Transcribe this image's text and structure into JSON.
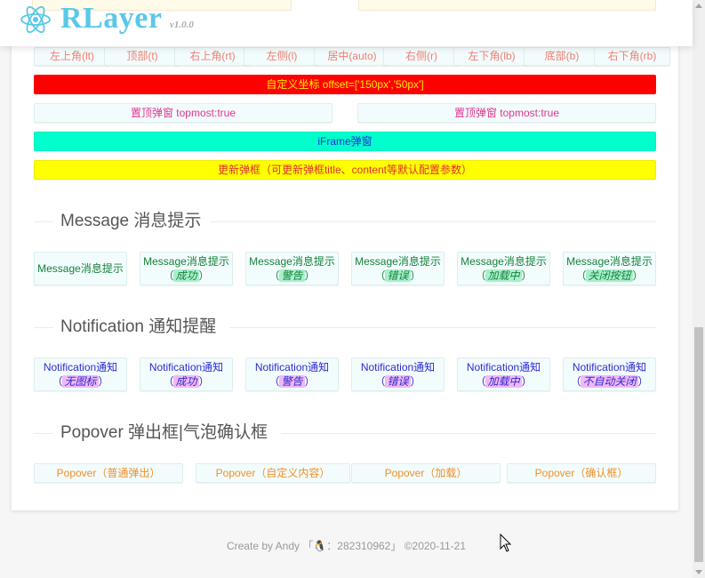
{
  "header": {
    "brand": "RLayer",
    "version": "v1.0.0"
  },
  "colors": {
    "position": "#f27e72",
    "custom_bg": "#ff0000",
    "topmost": "#e0358e",
    "iframe_bg": "#00ffcc",
    "update_bg": "#ffff00",
    "message": "#16813b",
    "notification": "#2b2bd4",
    "popover": "#f0902a",
    "brand": "#5ac8e8"
  },
  "position_buttons": [
    "左上角(lt)",
    "顶部(t)",
    "右上角(rt)",
    "左侧(l)",
    "居中(auto)",
    "右侧(r)",
    "左下角(lb)",
    "底部(b)",
    "右下角(rb)"
  ],
  "custom_offset_label": "自定义坐标 offset=['150px','50px']",
  "topmost_buttons": [
    "置顶弹窗 topmost:true",
    "置顶弹窗 topmost:true"
  ],
  "iframe_label": "iFrame弹窗",
  "update_label": "更新弹框（可更新弹框title、content等默认配置参数）",
  "message": {
    "title": "Message 消息提示",
    "buttons": [
      {
        "label": "Message消息提示",
        "tag": ""
      },
      {
        "label": "Message消息提示",
        "tag": "成功"
      },
      {
        "label": "Message消息提示",
        "tag": "警告"
      },
      {
        "label": "Message消息提示",
        "tag": "错误"
      },
      {
        "label": "Message消息提示",
        "tag": "加载中"
      },
      {
        "label": "Message消息提示",
        "tag": "关闭按钮"
      }
    ]
  },
  "notification": {
    "title": "Notification 通知提醒",
    "buttons": [
      {
        "label": "Notification通知",
        "tag": "无图标"
      },
      {
        "label": "Notification通知",
        "tag": "成功"
      },
      {
        "label": "Notification通知",
        "tag": "警告"
      },
      {
        "label": "Notification通知",
        "tag": "错误"
      },
      {
        "label": "Notification通知",
        "tag": "加载中"
      },
      {
        "label": "Notification通知",
        "tag": "不自动关闭"
      }
    ]
  },
  "popover": {
    "title": "Popover 弹出框|气泡确认框",
    "buttons": [
      "Popover（普通弹出）",
      "Popover（自定义内容）",
      "Popover（加载）",
      "Popover（确认框）"
    ]
  },
  "footer": "Create by Andy 「🐧：282310962」 ©2020-11-21"
}
